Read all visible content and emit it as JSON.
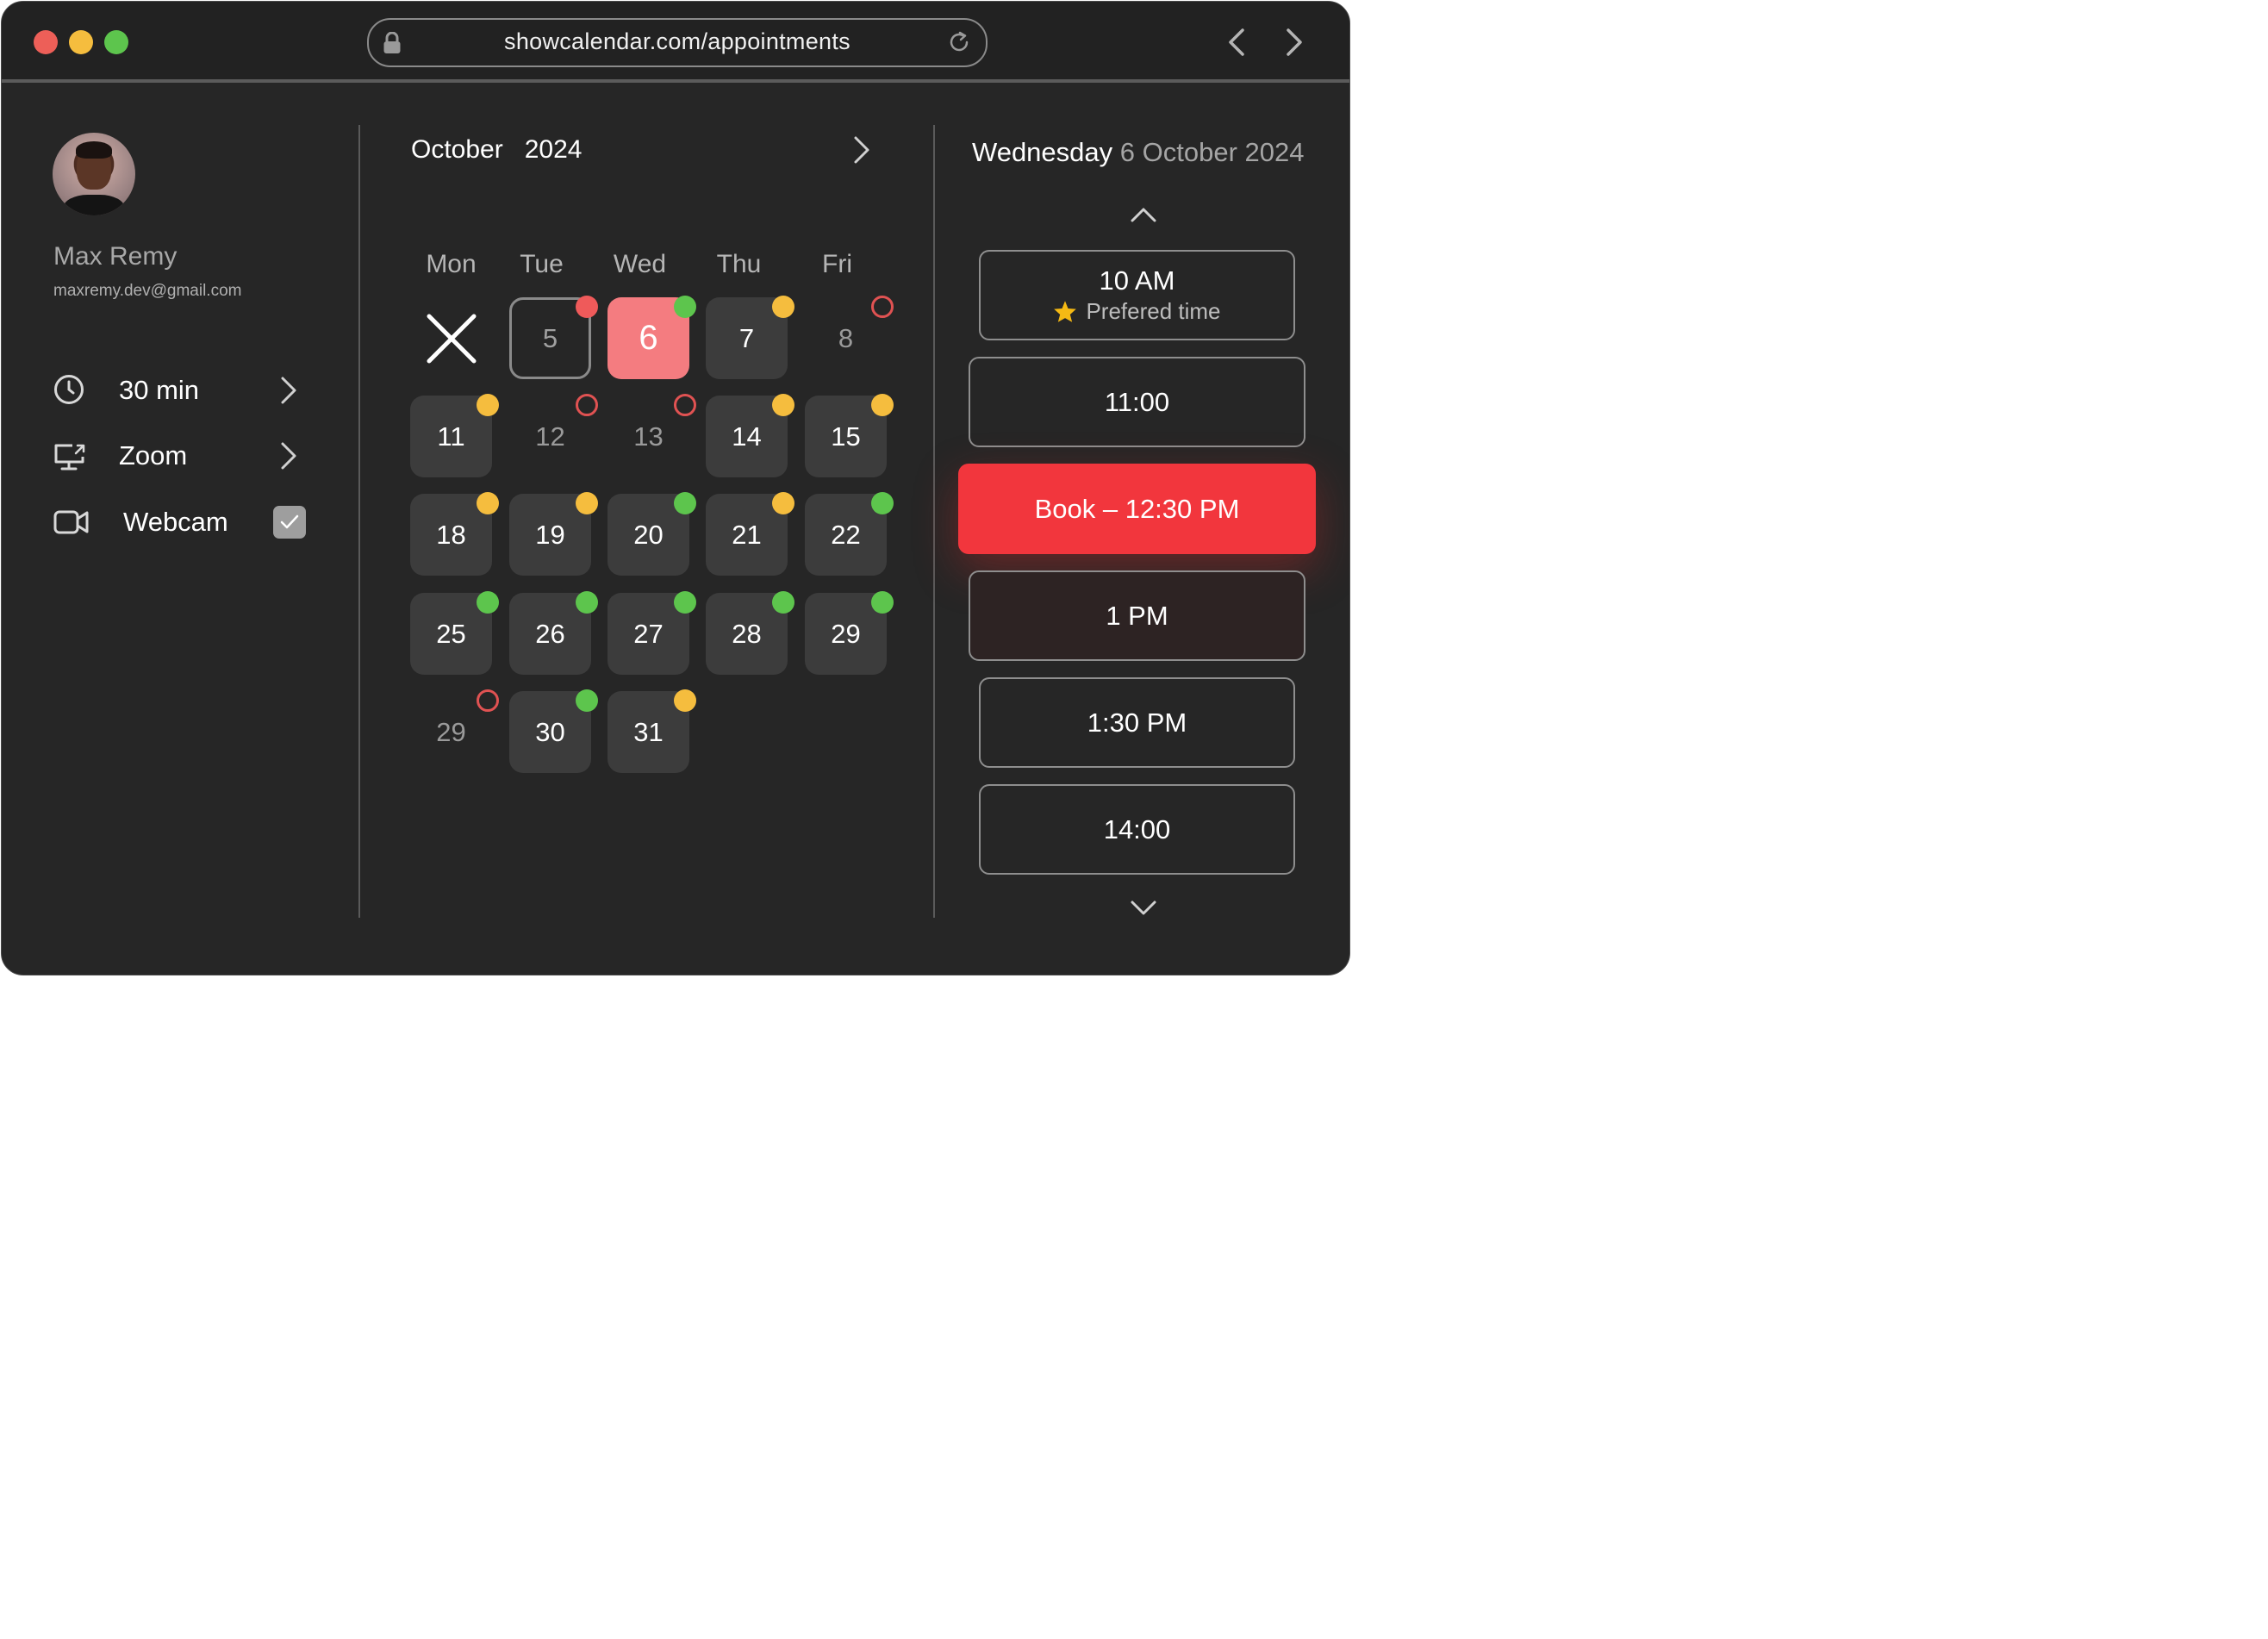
{
  "browser": {
    "url": "showcalendar.com/appointments",
    "traffic_colors": [
      "#ed5f58",
      "#f5bd3e",
      "#5dc54d"
    ]
  },
  "profile": {
    "name": "Max Remy",
    "email": "maxremy.dev@gmail.com",
    "options": [
      {
        "label": "30 min",
        "icon": "clock-icon",
        "control": "chevron"
      },
      {
        "label": "Zoom",
        "icon": "screen-share-icon",
        "control": "chevron"
      },
      {
        "label": "Webcam",
        "icon": "video-camera-icon",
        "control": "checkbox",
        "checked": true
      }
    ]
  },
  "calendar": {
    "month": "October",
    "year": "2024",
    "weekdays": [
      "Mon",
      "Tue",
      "Wed",
      "Thu",
      "Fri"
    ],
    "status_colors": {
      "available": "#5dc54d",
      "limited": "#f5bd3e",
      "full": "#ef5a5a",
      "none": "#e05252"
    },
    "weeks": [
      [
        {
          "day": "",
          "state": "unavailable",
          "dot": null
        },
        {
          "day": "5",
          "state": "outlined",
          "dot": "full"
        },
        {
          "day": "6",
          "state": "selected",
          "dot": "available"
        },
        {
          "day": "7",
          "state": "normal",
          "dot": "limited"
        },
        {
          "day": "8",
          "state": "empty",
          "dot": "none"
        }
      ],
      [
        {
          "day": "11",
          "state": "normal",
          "dot": "limited"
        },
        {
          "day": "12",
          "state": "empty",
          "dot": "none"
        },
        {
          "day": "13",
          "state": "empty",
          "dot": "none"
        },
        {
          "day": "14",
          "state": "normal",
          "dot": "limited"
        },
        {
          "day": "15",
          "state": "normal",
          "dot": "limited"
        }
      ],
      [
        {
          "day": "18",
          "state": "normal",
          "dot": "limited"
        },
        {
          "day": "19",
          "state": "normal",
          "dot": "limited"
        },
        {
          "day": "20",
          "state": "normal",
          "dot": "available"
        },
        {
          "day": "21",
          "state": "normal",
          "dot": "limited"
        },
        {
          "day": "22",
          "state": "normal",
          "dot": "available"
        }
      ],
      [
        {
          "day": "25",
          "state": "normal",
          "dot": "available"
        },
        {
          "day": "26",
          "state": "normal",
          "dot": "available"
        },
        {
          "day": "27",
          "state": "normal",
          "dot": "available"
        },
        {
          "day": "28",
          "state": "normal",
          "dot": "available"
        },
        {
          "day": "29",
          "state": "normal",
          "dot": "available"
        }
      ],
      [
        {
          "day": "29",
          "state": "empty",
          "dot": "none"
        },
        {
          "day": "30",
          "state": "normal",
          "dot": "available"
        },
        {
          "day": "31",
          "state": "normal",
          "dot": "limited"
        }
      ]
    ]
  },
  "schedule": {
    "weekday": "Wednesday",
    "date": "6 October 2024",
    "preferred_label": "Prefered time",
    "slots": [
      "10 AM",
      "11:00",
      "Book – 12:30 PM",
      "1 PM",
      "1:30 PM",
      "14:00"
    ]
  }
}
